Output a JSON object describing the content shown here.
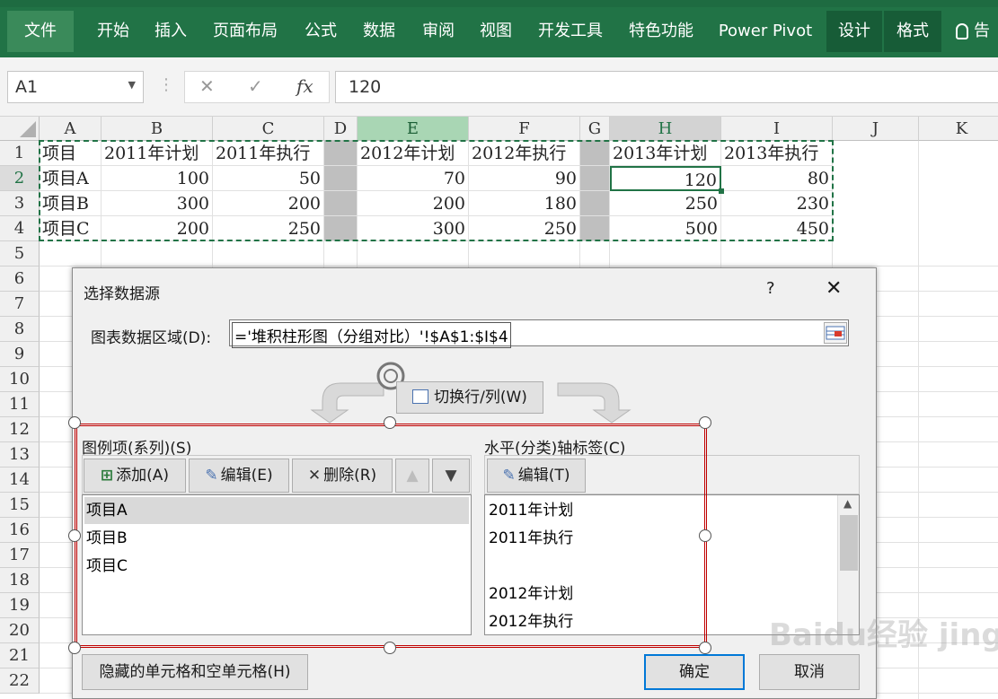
{
  "ribbon": {
    "tabs": [
      "文件",
      "开始",
      "插入",
      "页面布局",
      "公式",
      "数据",
      "审阅",
      "视图",
      "开发工具",
      "特色功能",
      "Power Pivot",
      "设计",
      "格式"
    ],
    "tell_me": "告"
  },
  "formula_bar": {
    "name_box": "A1",
    "fx": "fx",
    "value": "120"
  },
  "grid": {
    "columns": [
      "A",
      "B",
      "C",
      "D",
      "E",
      "F",
      "G",
      "H",
      "I",
      "J",
      "K"
    ],
    "rows": [
      "1",
      "2",
      "3",
      "4",
      "5",
      "6",
      "7",
      "8",
      "9",
      "10",
      "11",
      "12",
      "13",
      "14",
      "15",
      "16",
      "17",
      "18",
      "19",
      "20",
      "21",
      "22"
    ],
    "cells": {
      "r1": [
        "项目",
        "2011年计划",
        "2011年执行",
        "",
        "2012年计划",
        "2012年执行",
        "",
        "2013年计划",
        "2013年执行"
      ],
      "r2": [
        "项目A",
        "100",
        "50",
        "",
        "70",
        "90",
        "",
        "120",
        "80"
      ],
      "r3": [
        "项目B",
        "300",
        "200",
        "",
        "200",
        "180",
        "",
        "250",
        "230"
      ],
      "r4": [
        "项目C",
        "200",
        "250",
        "",
        "300",
        "250",
        "",
        "500",
        "450"
      ]
    }
  },
  "dialog": {
    "title": "选择数据源",
    "help": "?",
    "close": "✕",
    "range_label": "图表数据区域(D):",
    "range_value": "='堆积柱形图（分组对比）'!$A$1:$I$4",
    "switch_label": "切换行/列(W)",
    "series_label": "图例项(系列)(S)",
    "add_label": "添加(A)",
    "edit_label": "编辑(E)",
    "delete_label": "删除(R)",
    "series": [
      "项目A",
      "项目B",
      "项目C"
    ],
    "axis_label": "水平(分类)轴标签(C)",
    "axis_edit_label": "编辑(T)",
    "axis_items": [
      "2011年计划",
      "2011年执行",
      "",
      "2012年计划",
      "2012年执行"
    ],
    "hidden_cells_label": "隐藏的单元格和空单元格(H)",
    "ok_label": "确定",
    "cancel_label": "取消"
  },
  "watermark": "Baidu经验 jingyan.baidu.com",
  "colors": {
    "ribbon": "#217346",
    "selection_border": "#c00000",
    "hidden_column": "#bfbfbf"
  }
}
